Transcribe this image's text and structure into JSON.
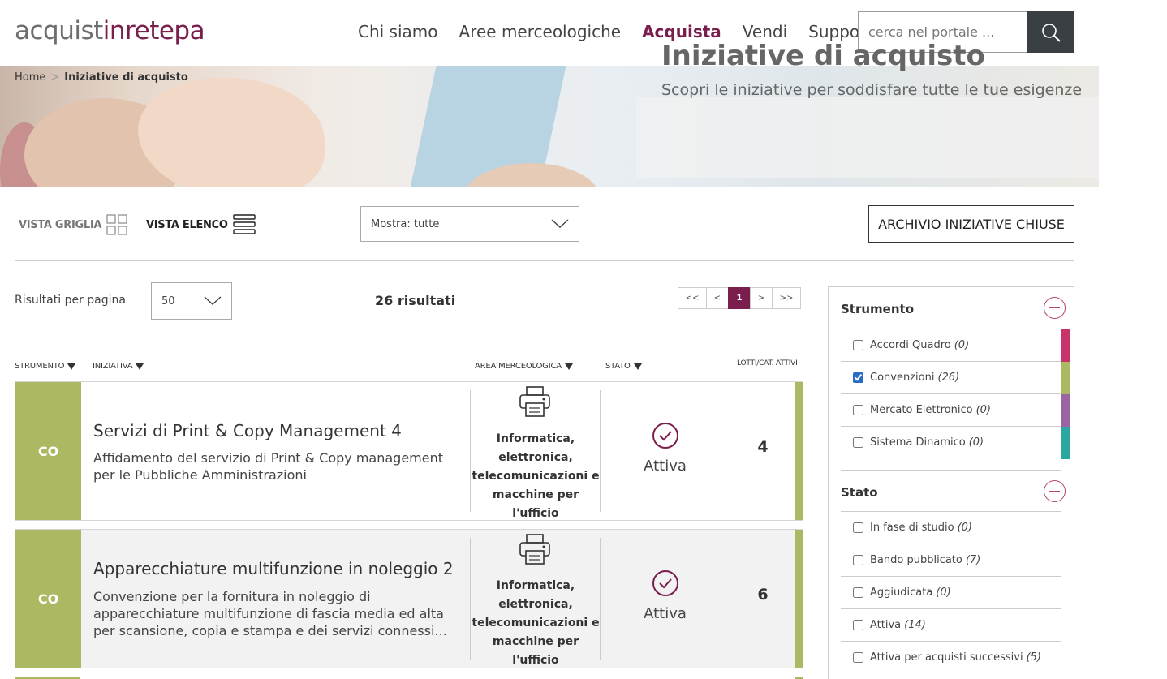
{
  "header": {
    "logo": {
      "part1": "acquist",
      "part2": "inrete",
      "part3": "pa"
    },
    "nav": [
      "Chi siamo",
      "Aree merceologiche",
      "Acquista",
      "Vendi",
      "Supporto"
    ],
    "nav_active": "Acquista",
    "search_placeholder": "cerca nel portale ..."
  },
  "breadcrumb": {
    "home": "Home",
    "sep": ">",
    "current": "Iniziative di acquisto"
  },
  "hero": {
    "title": "Iniziative di acquisto",
    "subtitle": "Scopri le iniziative per soddisfare tutte le tue esigenze"
  },
  "toolbar": {
    "view_grid": "VISTA GRIGLIA",
    "view_list": "VISTA ELENCO",
    "show_select": "Mostra: tutte",
    "archive": "ARCHIVIO INIZIATIVE CHIUSE"
  },
  "results": {
    "per_page_label": "Risultati per pagina",
    "per_page_value": "50",
    "count": "26 risultati",
    "pager": {
      "first": "<<",
      "prev": "<",
      "current": "1",
      "next": ">",
      "last": ">>"
    }
  },
  "table": {
    "headers": {
      "strumento": "STRUMENTO",
      "iniziativa": "INIZIATIVA",
      "area": "AREA MERCEOLOGICA",
      "stato": "STATO",
      "lotti": "LOTTI/CAT. ATTIVI"
    },
    "rows": [
      {
        "code": "CO",
        "title": "Servizi di Print & Copy Management 4",
        "desc": "Affidamento del servizio di Print & Copy management per le Pubbliche Amministrazioni",
        "area": "Informatica, elettronica, telecomunicazioni e macchine per l'ufficio",
        "area_icon": "printer-icon",
        "state": "Attiva",
        "lots": "4"
      },
      {
        "code": "CO",
        "title": "Apparecchiature multifunzione in noleggio 2",
        "desc": "Convenzione per la fornitura in noleggio di apparecchiature multifunzione di fascia media ed alta per scansione, copia e stampa e dei servizi connessi...",
        "area": "Informatica, elettronica, telecomunicazioni e macchine per l'ufficio",
        "area_icon": "printer-icon",
        "state": "Attiva",
        "lots": "6"
      }
    ]
  },
  "filters": {
    "strumento": {
      "title": "Strumento",
      "items": [
        {
          "label": "Accordi Quadro",
          "count": "(0)",
          "checked": false,
          "color": "#c8336b"
        },
        {
          "label": "Convenzioni",
          "count": "(26)",
          "checked": true,
          "color": "#adb862"
        },
        {
          "label": "Mercato Elettronico",
          "count": "(0)",
          "checked": false,
          "color": "#9b64a5"
        },
        {
          "label": "Sistema Dinamico",
          "count": "(0)",
          "checked": false,
          "color": "#2aa8a0"
        }
      ]
    },
    "stato": {
      "title": "Stato",
      "items": [
        {
          "label": "In fase di studio",
          "count": "(0)",
          "checked": false
        },
        {
          "label": "Bando pubblicato",
          "count": "(7)",
          "checked": false
        },
        {
          "label": "Aggiudicata",
          "count": "(0)",
          "checked": false
        },
        {
          "label": "Attiva",
          "count": "(14)",
          "checked": false
        },
        {
          "label": "Attiva per acquisti successivi",
          "count": "(5)",
          "checked": false
        }
      ]
    }
  },
  "colors": {
    "brand": "#7a1e4e",
    "convenzioni": "#adb862",
    "search_button": "#3a3f44"
  }
}
